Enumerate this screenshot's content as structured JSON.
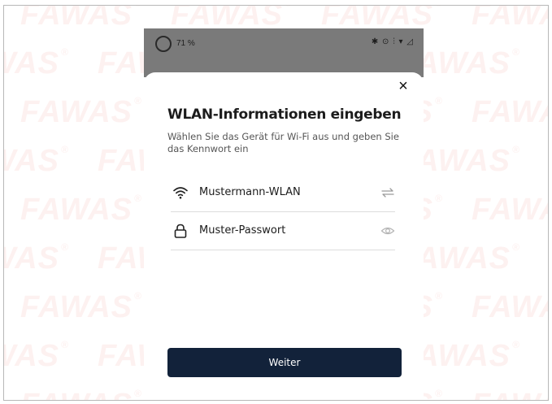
{
  "watermark_text": "FAWAS",
  "watermark_mark": "®",
  "status_bar": {
    "battery_percent": "71 %",
    "icons": [
      "bluetooth-icon",
      "alarm-icon",
      "vibrate-icon",
      "wifi-icon",
      "signal-icon"
    ]
  },
  "dialog": {
    "close_label": "×",
    "title": "WLAN-Informationen eingeben",
    "subtitle": "Wählen Sie das Gerät für Wi-Fi aus und geben Sie das Kennwort ein",
    "wifi_field": {
      "value": "Mustermann-WLAN",
      "leading_icon": "wifi-icon",
      "trailing_icon": "switch-arrows-icon"
    },
    "password_field": {
      "value": "Muster-Passwort",
      "leading_icon": "lock-icon",
      "trailing_icon": "eye-icon"
    },
    "next_button_label": "Weiter"
  },
  "colors": {
    "primary_button": "#12223a",
    "watermark": "#e8503c",
    "status_bar": "#7a7a7a"
  }
}
